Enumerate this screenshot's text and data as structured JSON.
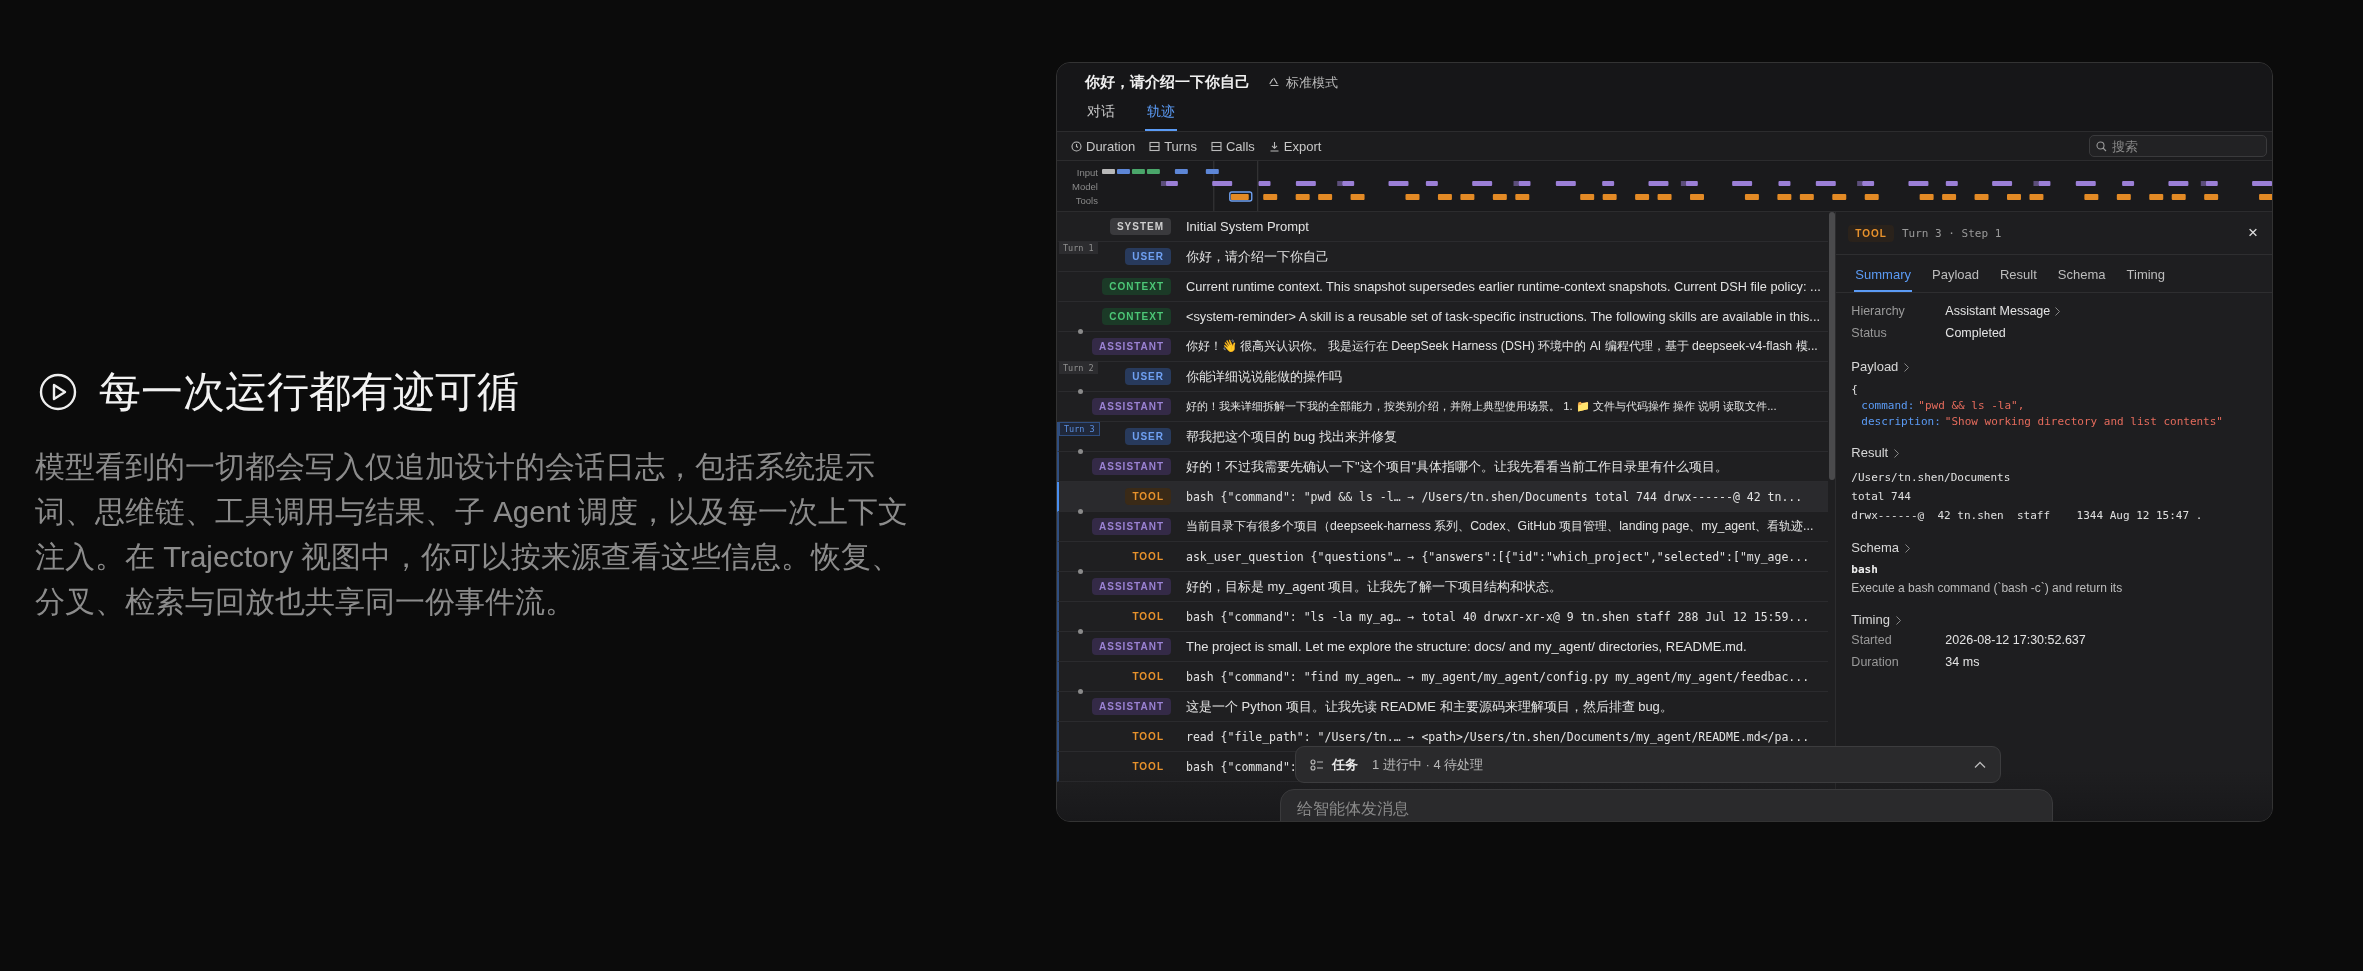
{
  "intro": {
    "heading": "每一次运行都有迹可循",
    "body": "模型看到的一切都会写入仅追加设计的会话日志，包括系统提示词、思维链、工具调用与结果、子 Agent 调度，以及每一次上下文注入。在 Trajectory 视图中，你可以按来源查看这些信息。恢复、分叉、检索与回放也共享同一份事件流。"
  },
  "window": {
    "title": "你好，请介绍一下你自己",
    "mode": "标准模式",
    "tabs": [
      {
        "label": "对话",
        "selected": false
      },
      {
        "label": "轨迹",
        "selected": true
      }
    ],
    "toolbar": [
      {
        "label": "Duration"
      },
      {
        "label": "Turns"
      },
      {
        "label": "Calls"
      },
      {
        "label": "Export"
      }
    ],
    "search": {
      "placeholder": "搜索"
    },
    "timeline": {
      "lanes": [
        "Input",
        "Model",
        "Tools"
      ]
    },
    "events": [
      {
        "kind": "system",
        "badge": "SYSTEM",
        "text": "Initial System Prompt",
        "selected": false
      },
      {
        "kind": "user",
        "badge": "USER",
        "text": "你好，请介绍一下你自己",
        "selected": false,
        "turn": {
          "label": "Turn 1",
          "active": false
        }
      },
      {
        "kind": "context",
        "badge": "CONTEXT",
        "text": "Current runtime context. This snapshot supersedes earlier runtime-context snapshots. Current DSH file policy: ...",
        "selected": false
      },
      {
        "kind": "context",
        "badge": "CONTEXT",
        "text": "<system-reminder> A skill is a reusable set of task-specific instructions. The following skills are available in this...",
        "selected": false
      },
      {
        "kind": "assistant",
        "badge": "ASSISTANT",
        "text": "你好！👋 很高兴认识你。 我是运行在 DeepSeek Harness (DSH) 环境中的 AI 编程代理，基于 deepseek-v4-flash 模...",
        "selected": false
      },
      {
        "kind": "user",
        "badge": "USER",
        "text": "你能详细说说能做的操作吗",
        "selected": false,
        "turn": {
          "label": "Turn 2",
          "active": false
        }
      },
      {
        "kind": "assistant",
        "badge": "ASSISTANT",
        "text": "好的！我来详细拆解一下我的全部能力，按类别介绍，并附上典型使用场景。 1. 📁 文件与代码操作 操作 说明 读取文件...",
        "selected": false
      },
      {
        "kind": "user",
        "badge": "USER",
        "text": "帮我把这个项目的 bug 找出来并修复",
        "selected": false,
        "turn": {
          "label": "Turn 3",
          "active": true
        }
      },
      {
        "kind": "assistant",
        "badge": "ASSISTANT",
        "text": "好的！不过我需要先确认一下\"这个项目\"具体指哪个。让我先看看当前工作目录里有什么项目。",
        "selected": false
      },
      {
        "kind": "tool",
        "badge": "TOOL",
        "text": "bash {\"command\": \"pwd && ls -l… → /Users/tn.shen/Documents total 744 drwx------@ 42 tn...",
        "selected": true
      },
      {
        "kind": "assistant",
        "badge": "ASSISTANT",
        "text": "当前目录下有很多个项目（deepseek-harness 系列、Codex、GitHub 项目管理、landing page、my_agent、看轨迹...",
        "selected": false
      },
      {
        "kind": "tool",
        "badge": "TOOL",
        "text": "ask_user_question {\"questions\"… → {\"answers\":[{\"id\":\"which_project\",\"selected\":[\"my_age...",
        "selected": false
      },
      {
        "kind": "assistant",
        "badge": "ASSISTANT",
        "text": "好的，目标是 my_agent 项目。让我先了解一下项目结构和状态。",
        "selected": false
      },
      {
        "kind": "tool",
        "badge": "TOOL",
        "text": "bash {\"command\": \"ls -la my_ag… → total 40 drwxr-xr-x@ 9 tn.shen staff 288 Jul 12 15:59...",
        "selected": false
      },
      {
        "kind": "assistant",
        "badge": "ASSISTANT",
        "text": "The project is small. Let me explore the structure: docs/ and my_agent/ directories, README.md.",
        "selected": false
      },
      {
        "kind": "tool",
        "badge": "TOOL",
        "text": "bash {\"command\": \"find my_agen… → my_agent/my_agent/config.py my_agent/my_agent/feedbac...",
        "selected": false
      },
      {
        "kind": "assistant",
        "badge": "ASSISTANT",
        "text": "这是一个 Python 项目。让我先读 README 和主要源码来理解项目，然后排查 bug。",
        "selected": false
      },
      {
        "kind": "tool",
        "badge": "TOOL",
        "text": "read {\"file_path\": \"/Users/tn.… → <path>/Users/tn.shen/Documents/my_agent/README.md</pa...",
        "selected": false
      },
      {
        "kind": "tool",
        "badge": "TOOL",
        "text": "bash {\"command\":",
        "selected": false
      }
    ],
    "detail": {
      "badge": "TOOL",
      "step": "Turn 3 · Step 1",
      "close": "×",
      "tabs": [
        {
          "label": "Summary",
          "selected": true
        },
        {
          "label": "Payload",
          "selected": false
        },
        {
          "label": "Result",
          "selected": false
        },
        {
          "label": "Schema",
          "selected": false
        },
        {
          "label": "Timing",
          "selected": false
        }
      ],
      "summary": [
        {
          "label": "Hierarchy",
          "value": "Assistant Message",
          "link": true
        },
        {
          "label": "Status",
          "value": "Completed",
          "link": false
        }
      ],
      "payload": {
        "title": "Payload",
        "open": "{",
        "fields": [
          {
            "key": "command:",
            "value": "\"pwd && ls -la\","
          },
          {
            "key": "description:",
            "value": "\"Show working directory and list contents\""
          }
        ]
      },
      "result": {
        "title": "Result",
        "lines": [
          "/Users/tn.shen/Documents",
          "total 744",
          "drwx------@  42 tn.shen  staff    1344 Aug 12 15:47 ."
        ]
      },
      "schema": {
        "title": "Schema",
        "name": "bash",
        "description": "Execute a bash command (`bash -c`) and return its"
      },
      "timing": {
        "title": "Timing",
        "rows": [
          {
            "label": "Started",
            "value": "2026-08-12 17:30:52.637"
          },
          {
            "label": "Duration",
            "value": "34 ms"
          }
        ]
      }
    },
    "tasks": {
      "title": "任务",
      "status": "1 进行中 · 4 待处理",
      "expanded": false
    },
    "composer": {
      "placeholder": "给智能体发消息"
    }
  }
}
